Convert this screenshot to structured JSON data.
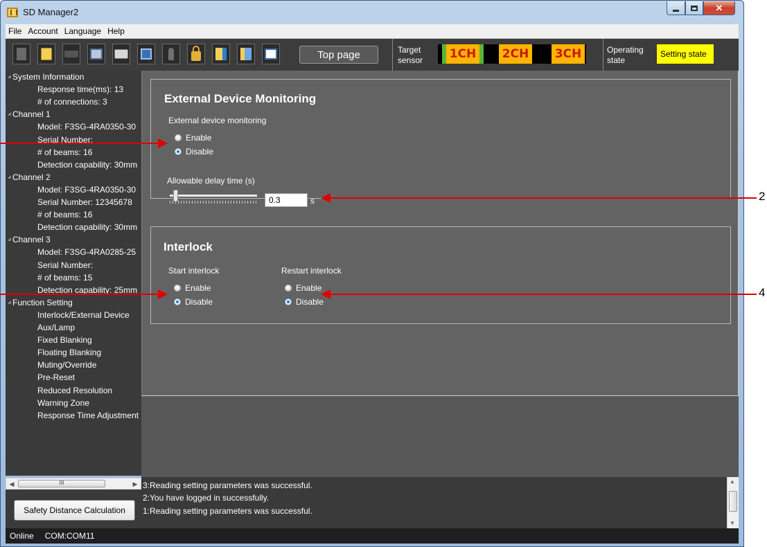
{
  "window": {
    "title": "SD Manager2"
  },
  "menu": [
    "File",
    "Account",
    "Language",
    "Help"
  ],
  "toolbar": {
    "icons": [
      "new-file-icon",
      "open-folder-icon",
      "connect-icon",
      "pc-download-icon",
      "print-icon",
      "monitor-icon",
      "key-icon",
      "lock-icon",
      "folder-download-icon",
      "folder-upload-icon",
      "list-icon"
    ],
    "top_page_label": "Top page",
    "target_sensor_label": "Target\nsensor",
    "channels": [
      "1CH",
      "2CH",
      "3CH"
    ],
    "operating_state_label": "Operating\nstate",
    "operating_state_value": "Setting state",
    "colors": {
      "channel_box": "#ffb400",
      "channel_text": "#c81b00",
      "state_box": "#ffff00"
    }
  },
  "tree": [
    {
      "label": "System Information",
      "level": 0
    },
    {
      "label": "Response time(ms): 13",
      "level": 1
    },
    {
      "label": "# of connections: 3",
      "level": 1
    },
    {
      "label": "Channel 1",
      "level": 0
    },
    {
      "label": "Model: F3SG-4RA0350-30",
      "level": 1
    },
    {
      "label": "Serial Number:",
      "level": 1
    },
    {
      "label": "# of beams: 16",
      "level": 1
    },
    {
      "label": "Detection capability: 30mm",
      "level": 1
    },
    {
      "label": "Channel 2",
      "level": 0
    },
    {
      "label": "Model: F3SG-4RA0350-30",
      "level": 1
    },
    {
      "label": "Serial Number: 12345678",
      "level": 1
    },
    {
      "label": "# of beams: 16",
      "level": 1
    },
    {
      "label": "Detection capability: 30mm",
      "level": 1
    },
    {
      "label": "Channel 3",
      "level": 0
    },
    {
      "label": "Model: F3SG-4RA0285-25",
      "level": 1
    },
    {
      "label": "Serial Number:",
      "level": 1
    },
    {
      "label": "# of beams: 15",
      "level": 1
    },
    {
      "label": "Detection capability: 25mm",
      "level": 1
    },
    {
      "label": "Function Setting",
      "level": 0
    },
    {
      "label": "Interlock/External Device",
      "level": 1
    },
    {
      "label": "Aux/Lamp",
      "level": 1
    },
    {
      "label": "Fixed Blanking",
      "level": 1
    },
    {
      "label": "Floating Blanking",
      "level": 1
    },
    {
      "label": "Muting/Override",
      "level": 1
    },
    {
      "label": "Pre-Reset",
      "level": 1
    },
    {
      "label": "Reduced Resolution",
      "level": 1
    },
    {
      "label": "Warning Zone",
      "level": 1
    },
    {
      "label": "Response Time Adjustment",
      "level": 1
    }
  ],
  "left_scroll_thumb_label": "III",
  "safety_distance_button": "Safety Distance Calculation",
  "edm": {
    "title": "External Device Monitoring",
    "field_label": "External device monitoring",
    "options": [
      "Enable",
      "Disable"
    ],
    "selected": "Disable",
    "delay_label": "Allowable delay time (s)",
    "delay_value": "0.3",
    "delay_unit": "s"
  },
  "interlock": {
    "title": "Interlock",
    "start_label": "Start interlock",
    "start_options": [
      "Enable",
      "Disable"
    ],
    "start_selected": "Disable",
    "restart_label": "Restart interlock",
    "restart_options": [
      "Enable",
      "Disable"
    ],
    "restart_selected": "Disable"
  },
  "messages": [
    "3:Reading setting parameters was successful.",
    "2:You have logged in successfully.",
    "1:Reading setting parameters was successful."
  ],
  "statusbar": {
    "connection": "Online",
    "port": "COM:COM11"
  },
  "annotations": {
    "right_top": "2",
    "right_bottom": "4",
    "color": "#e10000"
  }
}
